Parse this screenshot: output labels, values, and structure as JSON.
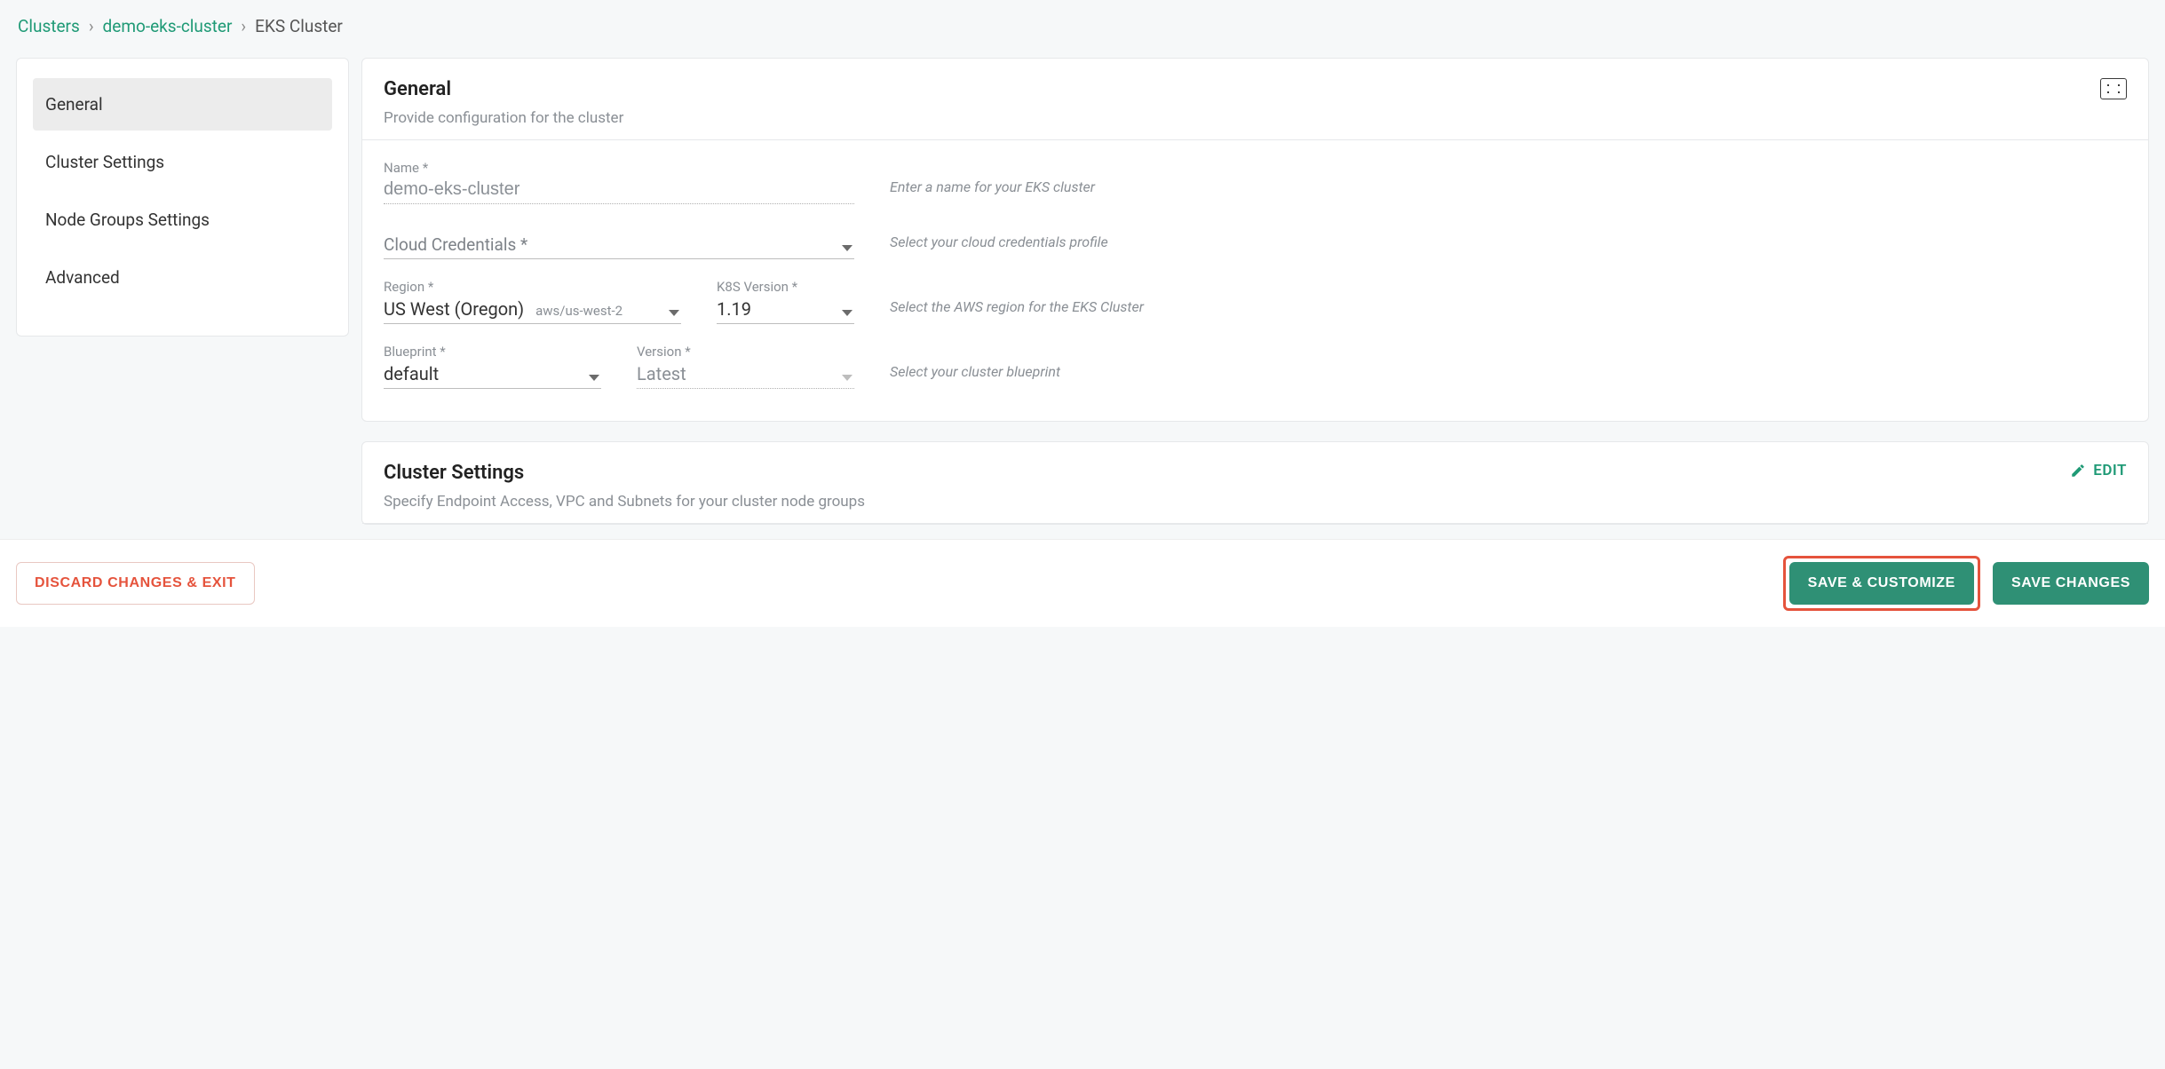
{
  "breadcrumb": {
    "root": "Clusters",
    "cluster": "demo-eks-cluster",
    "page": "EKS Cluster"
  },
  "sidebar": {
    "items": [
      {
        "label": "General",
        "active": true
      },
      {
        "label": "Cluster Settings",
        "active": false
      },
      {
        "label": "Node Groups Settings",
        "active": false
      },
      {
        "label": "Advanced",
        "active": false
      }
    ]
  },
  "general": {
    "title": "General",
    "subtitle": "Provide configuration for the cluster",
    "fields": {
      "name": {
        "label": "Name *",
        "value": "demo-eks-cluster",
        "help": "Enter a name for your EKS cluster"
      },
      "cloudCredentials": {
        "label": "Cloud Credentials *",
        "help": "Select your cloud credentials profile"
      },
      "region": {
        "label": "Region *",
        "value": "US West (Oregon)",
        "sub": "aws/us-west-2"
      },
      "k8s": {
        "label": "K8S Version *",
        "value": "1.19",
        "help": "Select the AWS region for the EKS Cluster"
      },
      "blueprint": {
        "label": "Blueprint *",
        "value": "default"
      },
      "version": {
        "label": "Version *",
        "value": "Latest",
        "help": "Select your cluster blueprint"
      }
    }
  },
  "clusterSettings": {
    "title": "Cluster Settings",
    "subtitle": "Specify Endpoint Access, VPC and Subnets for your cluster node groups",
    "editLabel": "EDIT"
  },
  "footer": {
    "discard": "DISCARD CHANGES & EXIT",
    "saveCustomize": "SAVE & CUSTOMIZE",
    "saveChanges": "SAVE CHANGES"
  }
}
